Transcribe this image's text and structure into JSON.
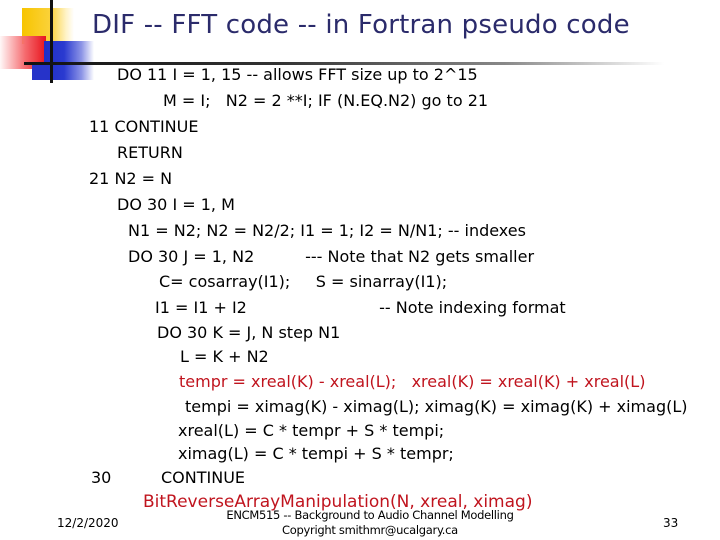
{
  "slide": {
    "title": "DIF -- FFT code -- in Fortran pseudo code",
    "code_lines": [
      {
        "text": "DO 11 I = 1, 15 -- allows FFT size up to 2^15",
        "color": "black"
      },
      {
        "text": "M = I;   N2 = 2 **I; IF (N.EQ.N2) go to 21",
        "color": "black"
      },
      {
        "text": "11 CONTINUE",
        "color": "black"
      },
      {
        "text": "RETURN",
        "color": "black"
      },
      {
        "text": "21 N2 = N",
        "color": "black"
      },
      {
        "text": "DO 30 I = 1, M",
        "color": "black"
      },
      {
        "text": "N1 = N2; N2 = N2/2; I1 = 1; I2 = N/N1; -- indexes",
        "color": "black"
      },
      {
        "text": "DO 30 J = 1, N2          --- Note that N2 gets smaller",
        "color": "black"
      },
      {
        "text": "C= cosarray(I1);     S = sinarray(I1);",
        "color": "black"
      },
      {
        "text": "I1 = I1 + I2                          -- Note indexing format",
        "color": "black"
      },
      {
        "text": "DO 30 K = J, N step N1",
        "color": "black"
      },
      {
        "text": "L = K + N2",
        "color": "black"
      },
      {
        "text": "tempr = xreal(K) - xreal(L);   xreal(K) = xreal(K) + xreal(L)",
        "color": "red"
      },
      {
        "text": "tempi = ximag(K) - ximag(L); ximag(K) = ximag(K) + ximag(L)",
        "color": "black"
      },
      {
        "text": "xreal(L) = C * tempr + S * tempi;",
        "color": "black"
      },
      {
        "text": "ximag(L) = C * tempi + S * tempr;",
        "color": "black"
      },
      {
        "text": "30",
        "color": "black"
      },
      {
        "text": "CONTINUE",
        "color": "black"
      },
      {
        "text": "BitReverseArrayManipulation(N, xreal, ximag)",
        "color": "red"
      }
    ],
    "colors": {
      "title": "#2b2b6b",
      "highlight": "#c0141e",
      "text": "#000000"
    }
  },
  "footer": {
    "date": "12/2/2020",
    "course": "ENCM515 -- Background to Audio Channel Modelling",
    "copyright": "Copyright smithmr@ucalgary.ca",
    "page_number": "33"
  }
}
